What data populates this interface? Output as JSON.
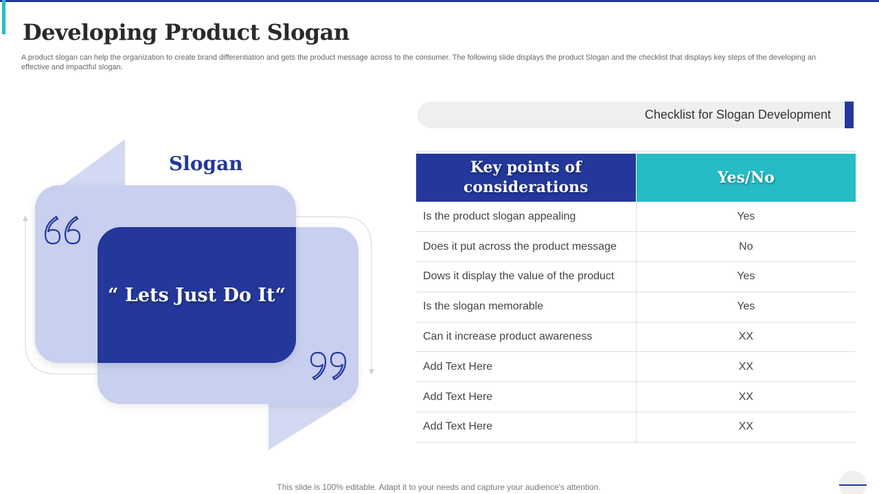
{
  "title": "Developing Product Slogan",
  "subtitle": "A product slogan can help the organization to create brand differentiation and gets the product message across to the consumer. The following slide displays the product Slogan and the checklist that displays key steps of the developing an effective  and impactful slogan.",
  "slogan": {
    "heading": "Slogan",
    "text": "“ Lets Just Do It“"
  },
  "checklist": {
    "title": "Checklist for Slogan Development",
    "headers": {
      "key": "Key points of considerations",
      "answer": "Yes/No"
    },
    "rows": [
      {
        "question": "Is the product slogan appealing",
        "answer": "Yes"
      },
      {
        "question": "Does it put across the product message",
        "answer": "No"
      },
      {
        "question": "Dows it display the value  of the product",
        "answer": "Yes"
      },
      {
        "question": "Is the slogan memorable",
        "answer": "Yes"
      },
      {
        "question": "Can it increase product awareness",
        "answer": "XX"
      },
      {
        "question": "Add Text Here",
        "answer": "XX"
      },
      {
        "question": "Add Text Here",
        "answer": "XX"
      },
      {
        "question": "Add Text Here",
        "answer": "XX"
      }
    ]
  },
  "footer": "This slide is 100% editable. Adapt it to your needs and capture your audience's attention.",
  "colors": {
    "navy": "#23389a",
    "teal": "#26bcc6",
    "lavender": "#c8cfef"
  },
  "icons": {
    "open_quote": "open-quote-icon",
    "close_quote": "close-quote-icon"
  }
}
